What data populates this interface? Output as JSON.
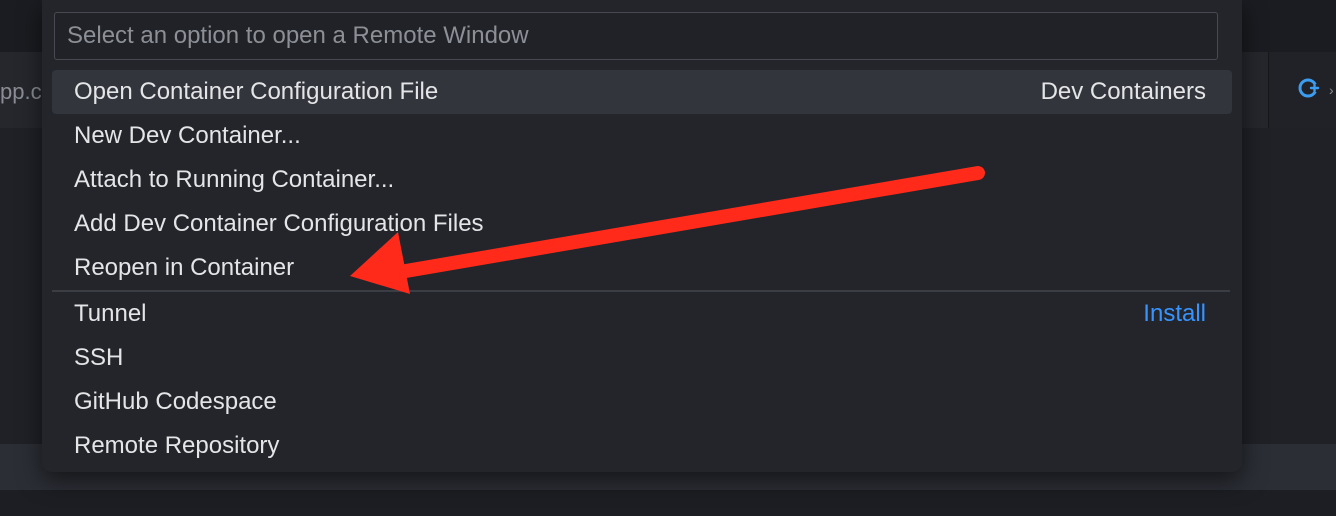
{
  "background": {
    "left_tab_fragment": "pp.c"
  },
  "quick_pick": {
    "placeholder": "Select an option to open a Remote Window",
    "groups": [
      {
        "items": [
          {
            "label": "Open Container Configuration File",
            "detail": "Dev Containers",
            "selected": true
          },
          {
            "label": "New Dev Container...",
            "detail": ""
          },
          {
            "label": "Attach to Running Container...",
            "detail": ""
          },
          {
            "label": "Add Dev Container Configuration Files",
            "detail": ""
          },
          {
            "label": "Reopen in Container",
            "detail": ""
          }
        ]
      },
      {
        "items": [
          {
            "label": "Tunnel",
            "detail": "Install"
          },
          {
            "label": "SSH",
            "detail": ""
          },
          {
            "label": "GitHub Codespace",
            "detail": ""
          },
          {
            "label": "Remote Repository",
            "detail": ""
          }
        ]
      }
    ]
  },
  "colors": {
    "accent_link": "#3794ff",
    "annotation_arrow": "#ff2a1a",
    "selected_row": "#32353c"
  },
  "icons": {
    "right_tab_icon": "copilot-icon"
  }
}
